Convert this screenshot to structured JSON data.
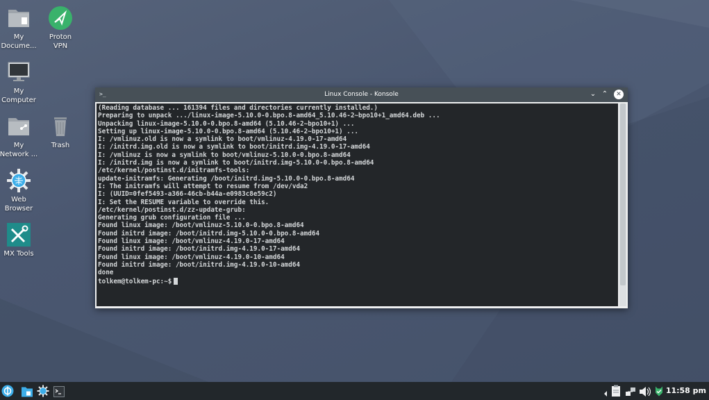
{
  "desktop": {
    "icons": [
      {
        "label": "My\nDocume..."
      },
      {
        "label": "Proton\nVPN"
      },
      {
        "label": "My\nComputer"
      },
      {
        "label": "My\nNetwork ..."
      },
      {
        "label": "Trash"
      },
      {
        "label": "Web\nBrowser"
      },
      {
        "label": "MX Tools"
      }
    ]
  },
  "window": {
    "title": "Linux Console - Konsole",
    "app_icon_text": ">_"
  },
  "terminal": {
    "output": "(Reading database ... 161394 files and directories currently installed.)\nPreparing to unpack .../linux-image-5.10.0-0.bpo.8-amd64_5.10.46-2~bpo10+1_amd64.deb ...\nUnpacking linux-image-5.10.0-0.bpo.8-amd64 (5.10.46-2~bpo10+1) ...\nSetting up linux-image-5.10.0-0.bpo.8-amd64 (5.10.46-2~bpo10+1) ...\nI: /vmlinuz.old is now a symlink to boot/vmlinuz-4.19.0-17-amd64\nI: /initrd.img.old is now a symlink to boot/initrd.img-4.19.0-17-amd64\nI: /vmlinuz is now a symlink to boot/vmlinuz-5.10.0-0.bpo.8-amd64\nI: /initrd.img is now a symlink to boot/initrd.img-5.10.0-0.bpo.8-amd64\n/etc/kernel/postinst.d/initramfs-tools:\nupdate-initramfs: Generating /boot/initrd.img-5.10.0-0.bpo.8-amd64\nI: The initramfs will attempt to resume from /dev/vda2\nI: (UUID=0fef5493-a366-46cb-b44a-e0983c8e59c2)\nI: Set the RESUME variable to override this.\n/etc/kernel/postinst.d/zz-update-grub:\nGenerating grub configuration file ...\nFound linux image: /boot/vmlinuz-5.10.0-0.bpo.8-amd64\nFound initrd image: /boot/initrd.img-5.10.0-0.bpo.8-amd64\nFound linux image: /boot/vmlinuz-4.19.0-17-amd64\nFound initrd image: /boot/initrd.img-4.19.0-17-amd64\nFound linux image: /boot/vmlinuz-4.19.0-10-amd64\nFound initrd image: /boot/initrd.img-4.19.0-10-amd64\ndone",
    "prompt": "tolkem@tolkem-pc:~$"
  },
  "taskbar": {
    "clock": "11:58 pm"
  },
  "colors": {
    "desktop": "#4f5c73",
    "terminal_bg": "#232629",
    "terminal_fg": "#d4d7d9",
    "titlebar": "#475057",
    "taskbar": "#22272b",
    "accent_blue": "#3daee9",
    "vpn_green": "#39b26b",
    "tools_teal": "#1f8c8a"
  }
}
